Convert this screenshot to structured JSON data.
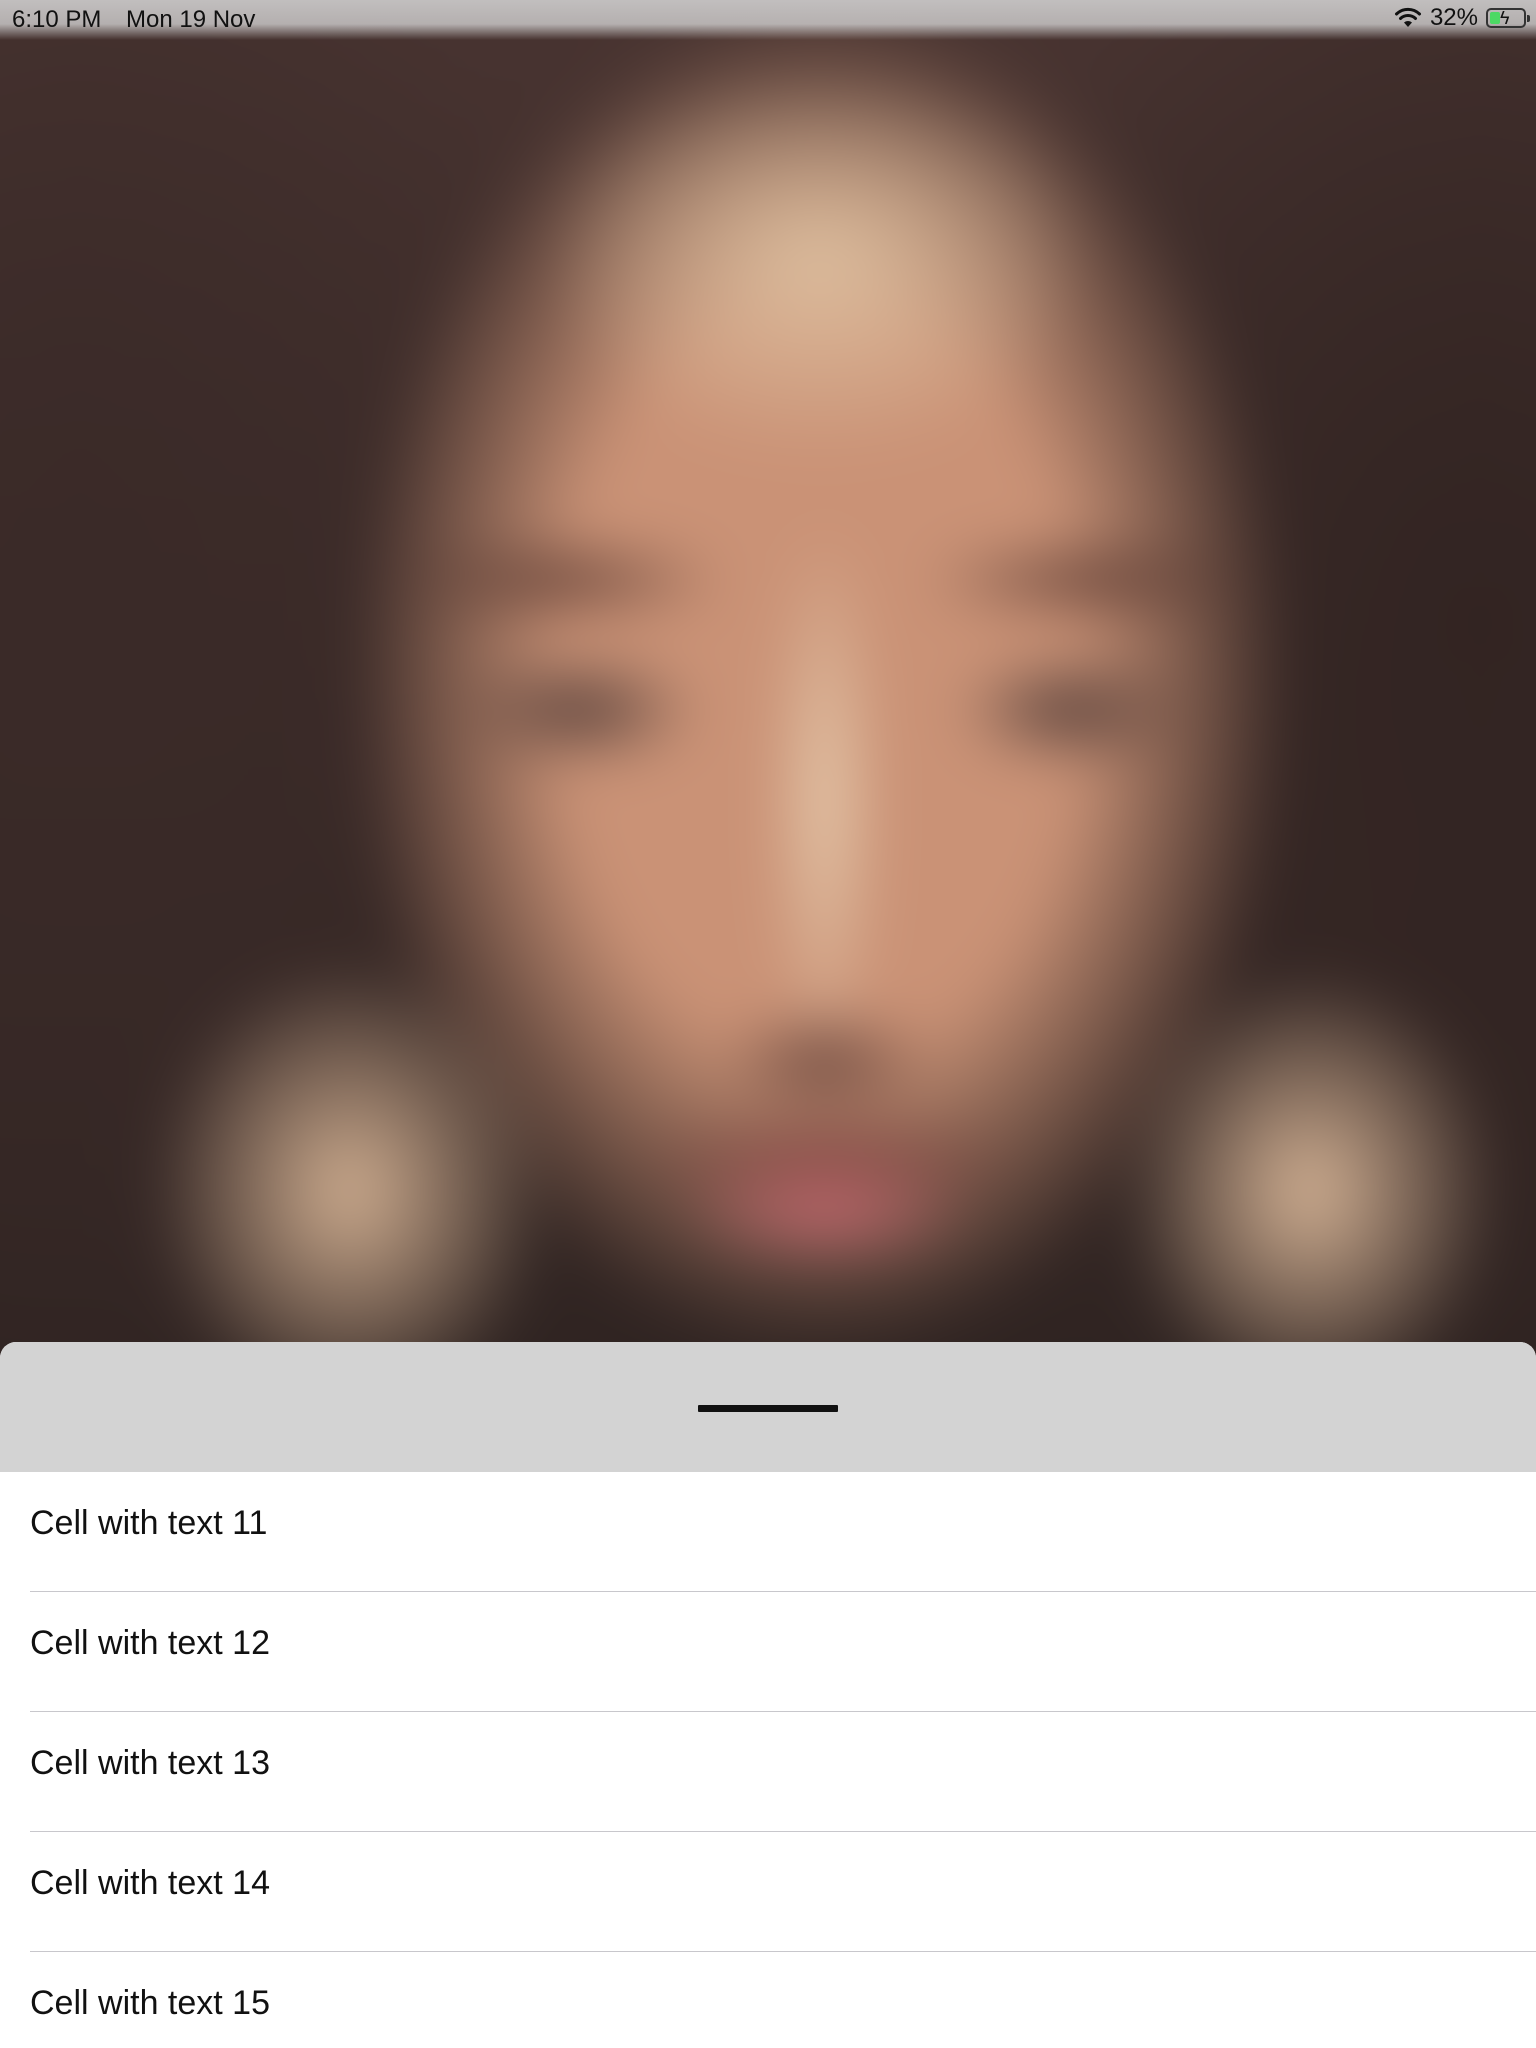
{
  "status_bar": {
    "time": "6:10 PM",
    "date": "Mon 19 Nov",
    "battery_percent": "32%",
    "battery_level": 0.32,
    "battery_fill_color": "#4cd964"
  },
  "icons": {
    "wifi": "wifi-icon",
    "battery": "battery-icon",
    "charging": "charging-bolt-icon"
  },
  "sheet": {
    "header_color": "#d3d3d3",
    "cells": [
      {
        "label": "Cell with text 11"
      },
      {
        "label": "Cell with text 12"
      },
      {
        "label": "Cell with text 13"
      },
      {
        "label": "Cell with text 14"
      },
      {
        "label": "Cell with text 15"
      }
    ]
  }
}
